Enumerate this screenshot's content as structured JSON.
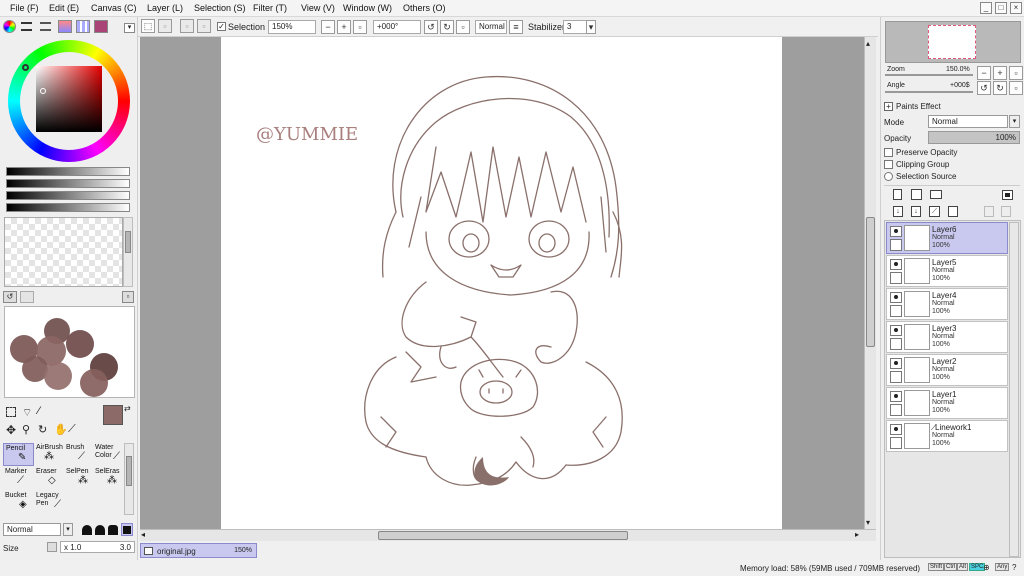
{
  "menu": {
    "items": [
      "File (F)",
      "Edit (E)",
      "Canvas (C)",
      "Layer (L)",
      "Selection (S)",
      "Filter (T)",
      "View (V)",
      "Window (W)",
      "Others (O)"
    ]
  },
  "window_buttons": {
    "minimize": "_",
    "restore": "□",
    "close": "×"
  },
  "toolbar": {
    "selection_label": "Selection",
    "zoom_value": "150%",
    "rotation_value": "+000°",
    "blend_mode": "Normal",
    "stabilizer_label": "Stabilizer",
    "stabilizer_value": "3"
  },
  "navigator": {
    "zoom_label": "Zoom",
    "zoom_value": "150.0%",
    "angle_label": "Angle",
    "angle_value": "+000$"
  },
  "layer_panel": {
    "paints_effect": "Paints Effect",
    "mode_label": "Mode",
    "mode_value": "Normal",
    "opacity_label": "Opacity",
    "opacity_value": "100%",
    "preserve_opacity": "Preserve Opacity",
    "clipping_group": "Clipping Group",
    "selection_source": "Selection Source"
  },
  "layers": [
    {
      "name": "Layer6",
      "mode": "Normal",
      "opacity": "100%",
      "selected": true
    },
    {
      "name": "Layer5",
      "mode": "Normal",
      "opacity": "100%",
      "selected": false
    },
    {
      "name": "Layer4",
      "mode": "Normal",
      "opacity": "100%",
      "selected": false
    },
    {
      "name": "Layer3",
      "mode": "Normal",
      "opacity": "100%",
      "selected": false
    },
    {
      "name": "Layer2",
      "mode": "Normal",
      "opacity": "100%",
      "selected": false
    },
    {
      "name": "Layer1",
      "mode": "Normal",
      "opacity": "100%",
      "selected": false
    },
    {
      "name": "Linework1",
      "mode": "Normal",
      "opacity": "100%",
      "selected": false
    }
  ],
  "tools": [
    {
      "name": "Pencil",
      "selected": true
    },
    {
      "name": "AirBrush",
      "selected": false
    },
    {
      "name": "Brush",
      "selected": false
    },
    {
      "name": "Water Color",
      "selected": false
    },
    {
      "name": "Marker",
      "selected": false
    },
    {
      "name": "Eraser",
      "selected": false
    },
    {
      "name": "SelPen",
      "selected": false
    },
    {
      "name": "SelEras",
      "selected": false
    },
    {
      "name": "Bucket",
      "selected": false
    },
    {
      "name": "Legacy Pen",
      "selected": false
    }
  ],
  "brush": {
    "mode": "Normal",
    "size_label": "Size",
    "size_multiplier": "x 1.0",
    "size_value": "3.0"
  },
  "colors": {
    "primary": "#8c6a67",
    "secondary": "#ffffff",
    "swatches": [
      "#6f4f4d",
      "#7b5654",
      "#8a6562",
      "#6e4a49",
      "#7f5b59",
      "#946f6c",
      "#5c3c3b",
      "#855f5c"
    ]
  },
  "canvas": {
    "watermark": "@YUMMIE",
    "line_color": "#8a706b"
  },
  "doc_tab": {
    "name": "original.jpg",
    "zoom": "150%"
  },
  "status": {
    "memory": "Memory load: 58% (59MB used / 709MB reserved)",
    "keys": [
      "Shift",
      "Ctrl",
      "Alt",
      "SPC",
      "Any"
    ]
  }
}
